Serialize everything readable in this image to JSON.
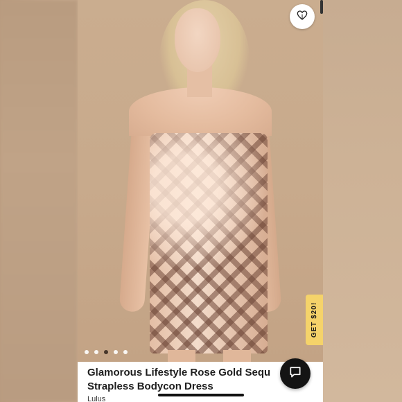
{
  "product": {
    "title_line1": "Glamorous Lifestyle Rose Gold Sequ",
    "title_line2": "Strapless Bodycon Dress",
    "brand": "Lulus"
  },
  "promo": {
    "label": "GET $20!",
    "color": "#f5d36a"
  },
  "carousel": {
    "total": 5,
    "active_index": 2
  },
  "icons": {
    "like": "heart-icon",
    "chat": "chat-icon"
  }
}
